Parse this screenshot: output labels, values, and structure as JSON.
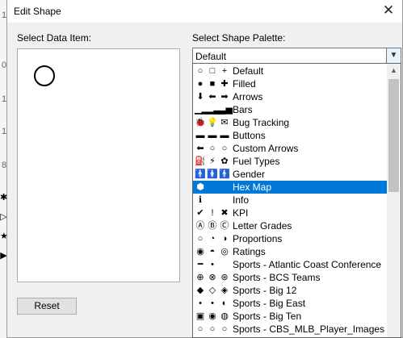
{
  "background": {
    "edge_glyphs": [
      "✱",
      "▷",
      "★",
      "▶"
    ],
    "edge_numbers": [
      "1",
      "0",
      "1",
      "1",
      "8"
    ]
  },
  "dialog": {
    "title": "Edit Shape",
    "close_glyph": "✕",
    "data_item_label": "Select Data Item:",
    "palette_label": "Select Shape Palette:",
    "reset_label": "Reset",
    "selected_palette": "Default"
  },
  "palettes": [
    {
      "label": "Default",
      "icons": [
        "○",
        "□",
        "+"
      ]
    },
    {
      "label": "Filled",
      "icons": [
        "●",
        "■",
        "✚"
      ]
    },
    {
      "label": "Arrows",
      "icons": [
        "⬇",
        "⬅",
        "➡"
      ]
    },
    {
      "label": "Bars",
      "icons": [
        "▁▂",
        "▂▃",
        "▃▅"
      ]
    },
    {
      "label": "Bug Tracking",
      "icons": [
        "🐞",
        "💡",
        "✉"
      ]
    },
    {
      "label": "Buttons",
      "icons": [
        "▬",
        "▬",
        "▬"
      ]
    },
    {
      "label": "Custom Arrows",
      "icons": [
        "⬅",
        "○",
        "○"
      ]
    },
    {
      "label": "Fuel Types",
      "icons": [
        "⛽",
        "⚡",
        "✿"
      ]
    },
    {
      "label": "Gender",
      "icons": [
        "🚹",
        "🚺",
        "🚹"
      ]
    },
    {
      "label": "Hex Map",
      "icons": [
        "⬢",
        "",
        ""
      ],
      "selected": true
    },
    {
      "label": "Info",
      "icons": [
        "ℹ",
        "",
        ""
      ]
    },
    {
      "label": "KPI",
      "icons": [
        "✔",
        "!",
        "✖"
      ]
    },
    {
      "label": "Letter Grades",
      "icons": [
        "Ⓐ",
        "Ⓑ",
        "Ⓒ"
      ]
    },
    {
      "label": "Proportions",
      "icons": [
        "○",
        "◔",
        "◑"
      ]
    },
    {
      "label": "Ratings",
      "icons": [
        "◉",
        "◓",
        "◎"
      ]
    },
    {
      "label": "Sports - Atlantic Coast Conference",
      "icons": [
        "━",
        "•",
        ""
      ]
    },
    {
      "label": "Sports - BCS Teams",
      "icons": [
        "⊕",
        "⊗",
        "⊛"
      ]
    },
    {
      "label": "Sports - Big 12",
      "icons": [
        "◆",
        "◇",
        "◈"
      ]
    },
    {
      "label": "Sports - Big East",
      "icons": [
        "•",
        "•",
        "◐"
      ]
    },
    {
      "label": "Sports - Big Ten",
      "icons": [
        "▣",
        "◉",
        "◍"
      ]
    },
    {
      "label": "Sports - CBS_MLB_Player_Images",
      "icons": [
        "○",
        "○",
        "○"
      ]
    }
  ],
  "colors": {
    "selection": "#0078d7",
    "dialog_bg": "#f0f0f0"
  }
}
